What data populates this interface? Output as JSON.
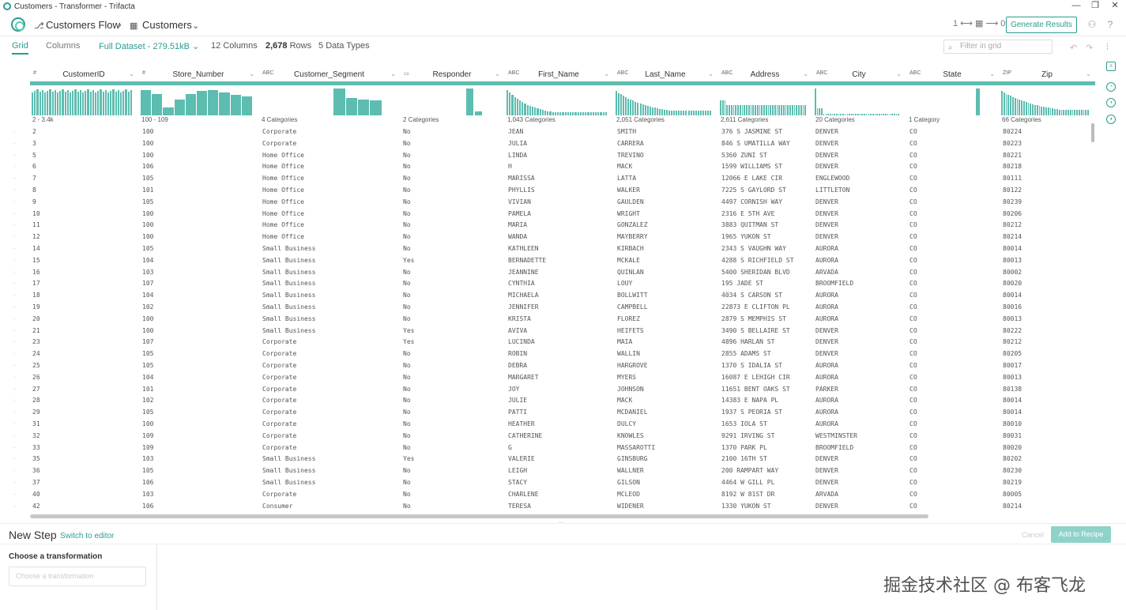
{
  "window": {
    "title": "Customers - Transformer - Trifacta"
  },
  "header": {
    "flow_name": "Customers Flow",
    "dataset_name": "Customers",
    "counter": "1 ⟷ ▦ ⟶ 0",
    "generate_label": "Generate Results"
  },
  "toolbar": {
    "tab_grid": "Grid",
    "tab_columns": "Columns",
    "dataset": "Full Dataset - 279.51kB",
    "columns_count": "12",
    "columns_label": "Columns",
    "rows_count": "2,678",
    "rows_label": "Rows",
    "types_count": "5",
    "types_label": "Data Types",
    "filter_placeholder": "Filter in grid"
  },
  "columns": [
    {
      "name": "CustomerID",
      "type": "#",
      "summary": "2 - 3.4k"
    },
    {
      "name": "Store_Number",
      "type": "#",
      "summary": "100 - 109"
    },
    {
      "name": "Customer_Segment",
      "type": "ABC",
      "summary": "4 Categories"
    },
    {
      "name": "Responder",
      "type": "▭",
      "summary": "2 Categories"
    },
    {
      "name": "First_Name",
      "type": "ABC",
      "summary": "1,043 Categories"
    },
    {
      "name": "Last_Name",
      "type": "ABC",
      "summary": "2,051 Categories"
    },
    {
      "name": "Address",
      "type": "ABC",
      "summary": "2,611 Categories"
    },
    {
      "name": "City",
      "type": "ABC",
      "summary": "20 Categories"
    },
    {
      "name": "State",
      "type": "ABC",
      "summary": "1 Category"
    },
    {
      "name": "Zip",
      "type": "ZIP",
      "summary": "66 Categories"
    }
  ],
  "rows": [
    [
      "2",
      "100",
      "Corporate",
      "No",
      "JEAN",
      "SMITH",
      "376 S JASMINE ST",
      "DENVER",
      "CO",
      "80224"
    ],
    [
      "3",
      "100",
      "Corporate",
      "No",
      "JULIA",
      "CARRERA",
      "846 S UMATILLA WAY",
      "DENVER",
      "CO",
      "80223"
    ],
    [
      "5",
      "100",
      "Home Office",
      "No",
      "LINDA",
      "TREVINO",
      "5360 ZUNI ST",
      "DENVER",
      "CO",
      "80221"
    ],
    [
      "6",
      "106",
      "Home Office",
      "No",
      "H",
      "MACK",
      "1599 WILLIAMS ST",
      "DENVER",
      "CO",
      "80218"
    ],
    [
      "7",
      "105",
      "Home Office",
      "No",
      "MARISSA",
      "LATTA",
      "12066 E LAKE CIR",
      "ENGLEWOOD",
      "CO",
      "80111"
    ],
    [
      "8",
      "101",
      "Home Office",
      "No",
      "PHYLLIS",
      "WALKER",
      "7225 S GAYLORD ST",
      "LITTLETON",
      "CO",
      "80122"
    ],
    [
      "9",
      "105",
      "Home Office",
      "No",
      "VIVIAN",
      "GAULDEN",
      "4497 CORNISH WAY",
      "DENVER",
      "CO",
      "80239"
    ],
    [
      "10",
      "100",
      "Home Office",
      "No",
      "PAMELA",
      "WRIGHT",
      "2316 E 5TH AVE",
      "DENVER",
      "CO",
      "80206"
    ],
    [
      "11",
      "100",
      "Home Office",
      "No",
      "MARIA",
      "GONZALEZ",
      "3883 QUITMAN ST",
      "DENVER",
      "CO",
      "80212"
    ],
    [
      "12",
      "100",
      "Home Office",
      "No",
      "WANDA",
      "MAYBERRY",
      "1965 YUKON ST",
      "DENVER",
      "CO",
      "80214"
    ],
    [
      "14",
      "105",
      "Small Business",
      "No",
      "KATHLEEN",
      "KIRBACH",
      "2343 S VAUGHN WAY",
      "AURORA",
      "CO",
      "80014"
    ],
    [
      "15",
      "104",
      "Small Business",
      "Yes",
      "BERNADETTE",
      "MCKALE",
      "4288 S RICHFIELD ST",
      "AURORA",
      "CO",
      "80013"
    ],
    [
      "16",
      "103",
      "Small Business",
      "No",
      "JEANNINE",
      "QUINLAN",
      "5400 SHERIDAN BLVD",
      "ARVADA",
      "CO",
      "80002"
    ],
    [
      "17",
      "107",
      "Small Business",
      "No",
      "CYNTHIA",
      "LOUY",
      "195 JADE ST",
      "BROOMFIELD",
      "CO",
      "80020"
    ],
    [
      "18",
      "104",
      "Small Business",
      "No",
      "MICHAELA",
      "BOLLWITT",
      "4034 S CARSON ST",
      "AURORA",
      "CO",
      "80014"
    ],
    [
      "19",
      "102",
      "Small Business",
      "No",
      "JENNIFER",
      "CAMPBELL",
      "22873 E CLIFTON PL",
      "AURORA",
      "CO",
      "80016"
    ],
    [
      "20",
      "100",
      "Small Business",
      "No",
      "KRISTA",
      "FLOREZ",
      "2879 S MEMPHIS ST",
      "AURORA",
      "CO",
      "80013"
    ],
    [
      "21",
      "100",
      "Small Business",
      "Yes",
      "AVIVA",
      "HEIFETS",
      "3490 S BELLAIRE ST",
      "DENVER",
      "CO",
      "80222"
    ],
    [
      "23",
      "107",
      "Corporate",
      "Yes",
      "LUCINDA",
      "MAIA",
      "4896 HARLAN ST",
      "DENVER",
      "CO",
      "80212"
    ],
    [
      "24",
      "105",
      "Corporate",
      "No",
      "ROBIN",
      "WALLIN",
      "2855 ADAMS ST",
      "DENVER",
      "CO",
      "80205"
    ],
    [
      "25",
      "105",
      "Corporate",
      "No",
      "DEBRA",
      "HARGROVE",
      "1370 S IDALIA ST",
      "AURORA",
      "CO",
      "80017"
    ],
    [
      "26",
      "104",
      "Corporate",
      "No",
      "MARGARET",
      "MYERS",
      "16087 E LEHIGH CIR",
      "AURORA",
      "CO",
      "80013"
    ],
    [
      "27",
      "101",
      "Corporate",
      "No",
      "JOY",
      "JOHNSON",
      "11651 BENT OAKS ST",
      "PARKER",
      "CO",
      "80138"
    ],
    [
      "28",
      "102",
      "Corporate",
      "No",
      "JULIE",
      "MACK",
      "14383 E NAPA PL",
      "AURORA",
      "CO",
      "80014"
    ],
    [
      "29",
      "105",
      "Corporate",
      "No",
      "PATTI",
      "MCDANIEL",
      "1937 S PEORIA ST",
      "AURORA",
      "CO",
      "80014"
    ],
    [
      "31",
      "100",
      "Corporate",
      "No",
      "HEATHER",
      "DULCY",
      "1653 IOLA ST",
      "AURORA",
      "CO",
      "80010"
    ],
    [
      "32",
      "109",
      "Corporate",
      "No",
      "CATHERINE",
      "KNOWLES",
      "9291 IRVING ST",
      "WESTMINSTER",
      "CO",
      "80031"
    ],
    [
      "33",
      "109",
      "Corporate",
      "No",
      "G",
      "MASSAROTTI",
      "1370 PARK PL",
      "BROOMFIELD",
      "CO",
      "80020"
    ],
    [
      "35",
      "103",
      "Small Business",
      "Yes",
      "VALERIE",
      "GINSBURG",
      "2100 16TH ST",
      "DENVER",
      "CO",
      "80202"
    ],
    [
      "36",
      "105",
      "Small Business",
      "No",
      "LEIGH",
      "WALLNER",
      "200 RAMPART WAY",
      "DENVER",
      "CO",
      "80230"
    ],
    [
      "37",
      "106",
      "Small Business",
      "No",
      "STACY",
      "GILSON",
      "4464 W GILL PL",
      "DENVER",
      "CO",
      "80219"
    ],
    [
      "40",
      "103",
      "Corporate",
      "No",
      "CHARLENE",
      "MCLEOD",
      "8192 W 81ST DR",
      "ARVADA",
      "CO",
      "80005"
    ],
    [
      "42",
      "106",
      "Consumer",
      "No",
      "TERESA",
      "WIDENER",
      "1330 YUKON ST",
      "DENVER",
      "CO",
      "80214"
    ]
  ],
  "new_step": {
    "title": "New Step",
    "switch_label": "Switch to editor",
    "cancel_label": "Cancel",
    "add_label": "Add to Recipe",
    "choose_label": "Choose a transformation",
    "choose_placeholder": "Choose a transformation"
  },
  "watermark": "掘金技术社区 @ 布客飞龙",
  "colors": {
    "accent": "#2a9d8f",
    "histogram": "#5cbdb0"
  }
}
